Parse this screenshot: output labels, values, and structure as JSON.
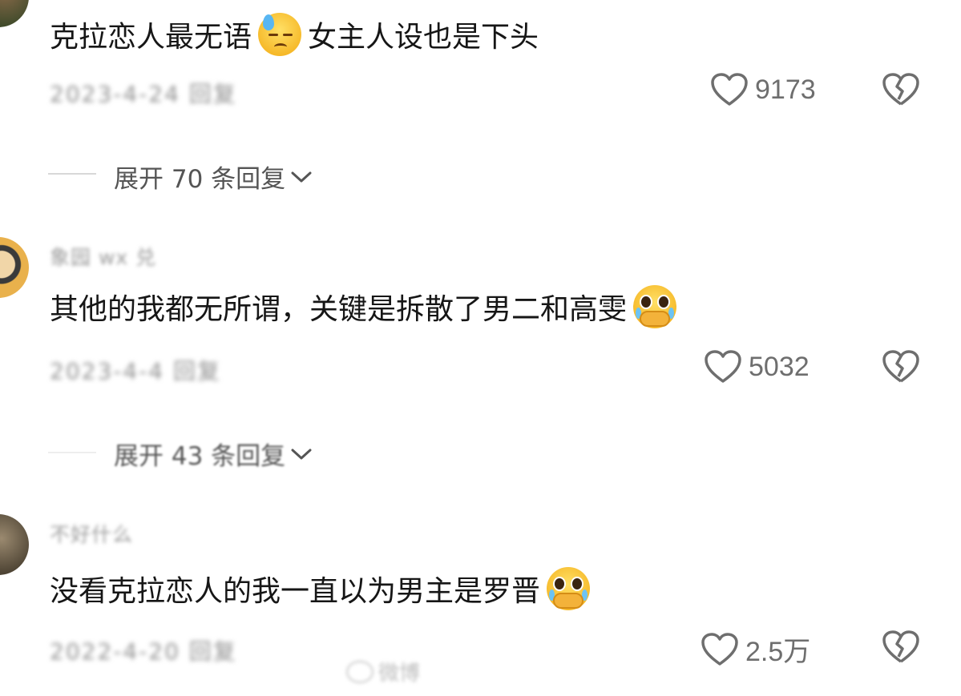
{
  "comments": [
    {
      "username": "",
      "text_before": "克拉恋人最无语",
      "text_after": "女主人设也是下头",
      "emoji": "downcast-sweat-emoji",
      "meta": "2023-4-24 回复",
      "likes": "9173",
      "expand_label": "展开 70 条回复"
    },
    {
      "username": "象园 wx 兑",
      "text_before": "其他的我都无所谓，关键是拆散了男二和高雯",
      "text_after": "",
      "emoji": "pleading-face-emoji",
      "meta": "2023-4-4 回复",
      "likes": "5032",
      "expand_label": "展开 43 条回复"
    },
    {
      "username": "不好什么",
      "text_before": "没看克拉恋人的我一直以为男主是罗晋",
      "text_after": "",
      "emoji": "pleading-face-emoji",
      "meta": "2022-4-20 回复",
      "likes": "2.5万",
      "expand_label": ""
    }
  ],
  "watermark": "微博",
  "colors": {
    "text": "#161616",
    "meta": "#8f8f8f",
    "count": "#6e6e6e",
    "icon": "#6e6e6e"
  }
}
